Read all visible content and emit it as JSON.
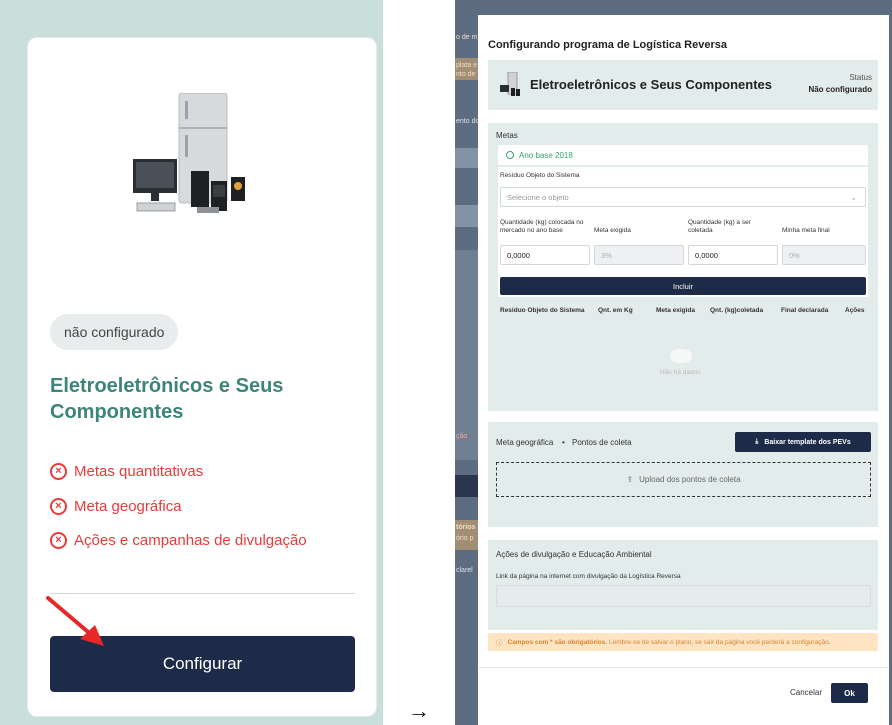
{
  "card": {
    "status_badge": "não configurado",
    "title": "Eletroeletrônicos e Seus Componentes",
    "items": [
      "Metas quantitativas",
      "Meta geográfica",
      "Ações e campanhas de divulgação"
    ],
    "config_button": "Configurar"
  },
  "flow_arrow": "→",
  "background_snippets": [
    "o de m",
    "plata e",
    "nto de",
    "ento do",
    "ção",
    "tórios",
    "ório p",
    "clarel"
  ],
  "modal": {
    "title": "Configurando programa de Logística Reversa",
    "header_name": "Eletroeletrônicos e Seus Componentes",
    "status_label": "Status",
    "status_value": "Não configurado",
    "metas": {
      "label": "Metas",
      "ano_base": "Ano base 2018",
      "residuo_label": "Resíduo Objeto do Sistema",
      "residuo_placeholder": "Selecione o objeto",
      "qtd_colocada_label": "Quantidade (kg) colocada no mercado no ano base",
      "meta_exigida_label": "Meta exigida",
      "qtd_coletada_label": "Quantidade (kg) a ser coletada",
      "minha_meta_label": "Minha meta final",
      "qtd_colocada_value": "0,0000",
      "meta_exigida_value": "3%",
      "qtd_coletada_value": "0,0000",
      "minha_meta_value": "0%",
      "incluir_button": "Incluir",
      "table_headers": [
        "Resíduo Objeto do Sistema",
        "Qnt. em Kg",
        "Meta exigida",
        "Qnt. (kg)coletada",
        "Final declarada",
        "Ações"
      ],
      "empty_text": "Não há dados"
    },
    "geo": {
      "label1": "Meta geográfica",
      "bullet": "•",
      "label2": "Pontos de coleta",
      "pev_button": "Baixar template dos PEVs",
      "upload_text": "Upload dos pontos de coleta"
    },
    "acoes": {
      "title": "Ações de divulgação e Educação Ambiental",
      "link_label": "Link da página na internet com divulgação da Logística Reversa"
    },
    "warning": {
      "bold": "Campos com * são obrigatórios.",
      "text": " Lembre-se de salvar o plano, se sair da página você perderá a configuração."
    },
    "cancel_button": "Cancelar",
    "ok_button": "Ok"
  },
  "colors": {
    "accent_green": "#3d8578",
    "error_red": "#ea3a3a",
    "navy": "#1d2a48",
    "panel_bg": "#e2ecea",
    "warning_bg": "#fde5c4"
  }
}
